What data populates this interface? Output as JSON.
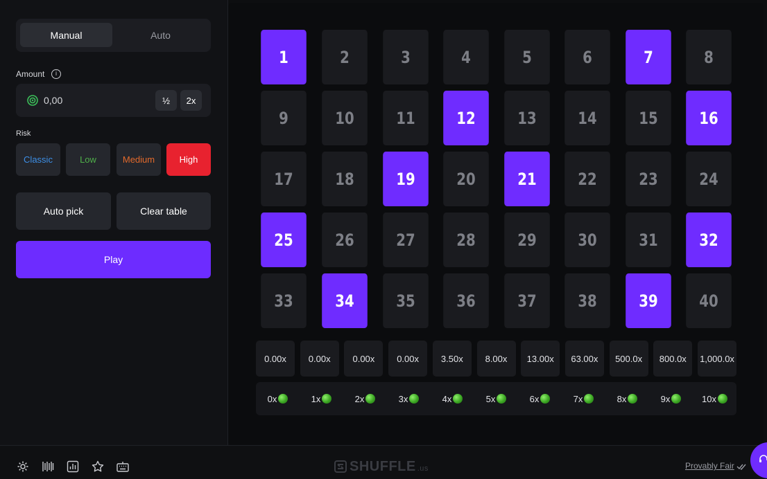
{
  "tabs": [
    {
      "label": "Manual",
      "active": true
    },
    {
      "label": "Auto",
      "active": false
    }
  ],
  "amount": {
    "label": "Amount",
    "value": "0,00",
    "half_label": "½",
    "double_label": "2x"
  },
  "risk": {
    "label": "Risk",
    "options": [
      {
        "label": "Classic",
        "color": "#3d8fe6"
      },
      {
        "label": "Low",
        "color": "#4fb04a"
      },
      {
        "label": "Medium",
        "color": "#e36a2c"
      },
      {
        "label": "High",
        "color": "#ffffff",
        "selected": true,
        "bg": "#e8222f"
      }
    ]
  },
  "actions": {
    "auto_pick": "Auto pick",
    "clear_table": "Clear table",
    "play": "Play"
  },
  "board": {
    "tiles": [
      "1",
      "2",
      "3",
      "4",
      "5",
      "6",
      "7",
      "8",
      "9",
      "10",
      "11",
      "12",
      "13",
      "14",
      "15",
      "16",
      "17",
      "18",
      "19",
      "20",
      "21",
      "22",
      "23",
      "24",
      "25",
      "26",
      "27",
      "28",
      "29",
      "30",
      "31",
      "32",
      "33",
      "34",
      "35",
      "36",
      "37",
      "38",
      "39",
      "40"
    ],
    "selected": [
      "1",
      "7",
      "12",
      "16",
      "19",
      "21",
      "25",
      "32",
      "34",
      "39"
    ]
  },
  "multipliers": [
    "0.00x",
    "0.00x",
    "0.00x",
    "0.00x",
    "3.50x",
    "8.00x",
    "13.00x",
    "63.00x",
    "500.0x",
    "800.0x",
    "1,000.0x"
  ],
  "hits": [
    "0x",
    "1x",
    "2x",
    "3x",
    "4x",
    "5x",
    "6x",
    "7x",
    "8x",
    "9x",
    "10x"
  ],
  "footer": {
    "logo": "SHUFFLE",
    "logo_suffix": ".us",
    "provably_fair": "Provably Fair",
    "icons": [
      "gear-icon",
      "barcode-icon",
      "chart-icon",
      "star-icon",
      "keyboard-icon"
    ]
  },
  "accent": "#6f2cff"
}
